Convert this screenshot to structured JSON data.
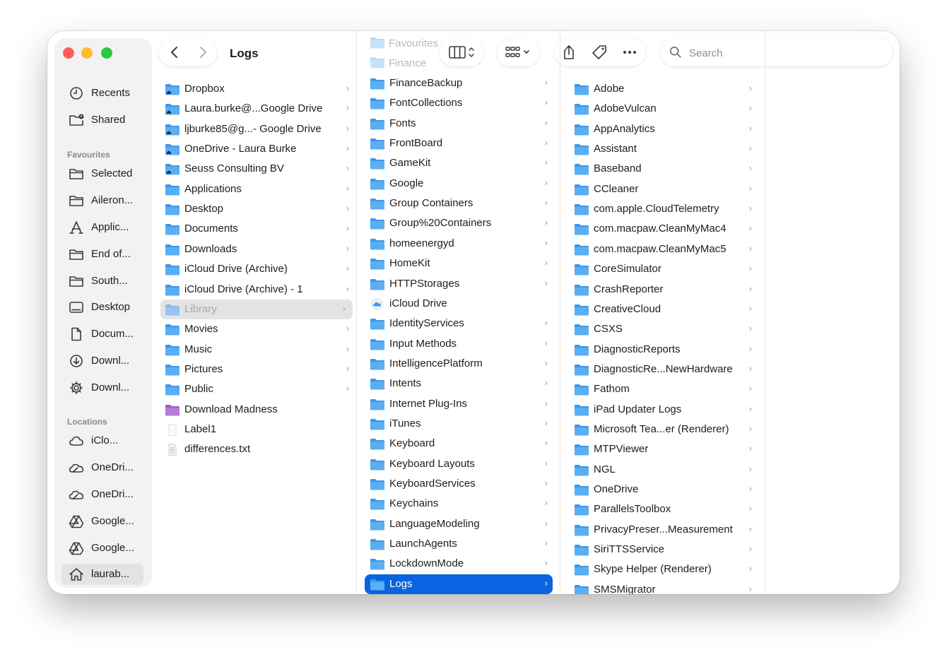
{
  "window": {
    "title": "Logs"
  },
  "colors": {
    "folder": "#5aaef4",
    "folder_tab": "#3e97e8",
    "selection": "#0a63e0",
    "purple_folder": "#b77ad9"
  },
  "sidebar": {
    "favourites_header": "Favourites",
    "locations_header": "Locations",
    "items": [
      {
        "label": "Recents",
        "icon": "clock-icon"
      },
      {
        "label": "Shared",
        "icon": "shared-folder-icon"
      },
      {
        "label": "Selected",
        "icon": "folder-icon"
      },
      {
        "label": "Aileron...",
        "icon": "folder-icon"
      },
      {
        "label": "Applic...",
        "icon": "applications-icon"
      },
      {
        "label": "End of...",
        "icon": "folder-icon"
      },
      {
        "label": "South...",
        "icon": "folder-icon"
      },
      {
        "label": "Desktop",
        "icon": "desktop-icon"
      },
      {
        "label": "Docum...",
        "icon": "document-icon"
      },
      {
        "label": "Downl...",
        "icon": "download-icon"
      },
      {
        "label": "Downl...",
        "icon": "gear-icon"
      },
      {
        "label": "iClo...",
        "icon": "cloud-icon"
      },
      {
        "label": "OneDri...",
        "icon": "onedrive-icon"
      },
      {
        "label": "OneDri...",
        "icon": "onedrive-icon"
      },
      {
        "label": "Google...",
        "icon": "google-drive-icon"
      },
      {
        "label": "Google...",
        "icon": "google-drive-icon"
      },
      {
        "label": "laurab...",
        "icon": "home-icon"
      }
    ]
  },
  "toolbar": {
    "search_placeholder": "Search",
    "ghost_rows": [
      "Favourites",
      "Finance"
    ]
  },
  "columns": [
    {
      "items": [
        {
          "name": "Dropbox",
          "icon": "cloud-folder-icon",
          "chevron": true
        },
        {
          "name": "Laura.burke@...Google Drive",
          "icon": "cloud-folder-icon",
          "chevron": true
        },
        {
          "name": "ljburke85@g...- Google Drive",
          "icon": "cloud-folder-icon",
          "chevron": true
        },
        {
          "name": "OneDrive - Laura Burke",
          "icon": "cloud-folder-icon",
          "chevron": true
        },
        {
          "name": "Seuss Consulting BV",
          "icon": "cloud-folder-icon",
          "chevron": true
        },
        {
          "name": "Applications",
          "icon": "folder-icon",
          "chevron": true
        },
        {
          "name": "Desktop",
          "icon": "folder-icon",
          "chevron": true
        },
        {
          "name": "Documents",
          "icon": "folder-icon",
          "chevron": true
        },
        {
          "name": "Downloads",
          "icon": "folder-icon",
          "chevron": true
        },
        {
          "name": "iCloud Drive (Archive)",
          "icon": "folder-icon",
          "chevron": true
        },
        {
          "name": "iCloud Drive (Archive) - 1",
          "icon": "folder-icon",
          "chevron": true
        },
        {
          "name": "Library",
          "icon": "folder-icon",
          "chevron": true,
          "state": "dim"
        },
        {
          "name": "Movies",
          "icon": "folder-icon",
          "chevron": true
        },
        {
          "name": "Music",
          "icon": "folder-icon",
          "chevron": true
        },
        {
          "name": "Pictures",
          "icon": "folder-icon",
          "chevron": true
        },
        {
          "name": "Public",
          "icon": "folder-icon",
          "chevron": true
        },
        {
          "name": "Download Madness",
          "icon": "purple-folder-icon",
          "chevron": false
        },
        {
          "name": "Label1",
          "icon": "blank-file-icon",
          "chevron": false
        },
        {
          "name": "differences.txt",
          "icon": "text-file-icon",
          "chevron": false
        }
      ]
    },
    {
      "items": [
        {
          "name": "FinanceBackup",
          "icon": "folder-icon",
          "chevron": true
        },
        {
          "name": "FontCollections",
          "icon": "folder-icon",
          "chevron": true
        },
        {
          "name": "Fonts",
          "icon": "folder-icon",
          "chevron": true
        },
        {
          "name": "FrontBoard",
          "icon": "folder-icon",
          "chevron": true
        },
        {
          "name": "GameKit",
          "icon": "folder-icon",
          "chevron": true
        },
        {
          "name": "Google",
          "icon": "folder-icon",
          "chevron": true
        },
        {
          "name": "Group Containers",
          "icon": "folder-icon",
          "chevron": true
        },
        {
          "name": "Group%20Containers",
          "icon": "folder-icon",
          "chevron": true
        },
        {
          "name": "homeenergyd",
          "icon": "folder-icon",
          "chevron": true
        },
        {
          "name": "HomeKit",
          "icon": "folder-icon",
          "chevron": true
        },
        {
          "name": "HTTPStorages",
          "icon": "folder-icon",
          "chevron": true
        },
        {
          "name": "iCloud Drive",
          "icon": "icloud-icon",
          "chevron": false
        },
        {
          "name": "IdentityServices",
          "icon": "folder-icon",
          "chevron": true
        },
        {
          "name": "Input Methods",
          "icon": "folder-icon",
          "chevron": true
        },
        {
          "name": "IntelligencePlatform",
          "icon": "folder-icon",
          "chevron": true
        },
        {
          "name": "Intents",
          "icon": "folder-icon",
          "chevron": true
        },
        {
          "name": "Internet Plug-Ins",
          "icon": "folder-icon",
          "chevron": true
        },
        {
          "name": "iTunes",
          "icon": "folder-icon",
          "chevron": true
        },
        {
          "name": "Keyboard",
          "icon": "folder-icon",
          "chevron": true
        },
        {
          "name": "Keyboard Layouts",
          "icon": "folder-icon",
          "chevron": true
        },
        {
          "name": "KeyboardServices",
          "icon": "folder-icon",
          "chevron": true
        },
        {
          "name": "Keychains",
          "icon": "folder-icon",
          "chevron": true
        },
        {
          "name": "LanguageModeling",
          "icon": "folder-icon",
          "chevron": true
        },
        {
          "name": "LaunchAgents",
          "icon": "folder-icon",
          "chevron": true
        },
        {
          "name": "LockdownMode",
          "icon": "folder-icon",
          "chevron": true
        },
        {
          "name": "Logs",
          "icon": "folder-icon",
          "chevron": true,
          "state": "selected"
        }
      ]
    },
    {
      "items": [
        {
          "name": "Adobe",
          "icon": "folder-icon",
          "chevron": true
        },
        {
          "name": "AdobeVulcan",
          "icon": "folder-icon",
          "chevron": true
        },
        {
          "name": "AppAnalytics",
          "icon": "folder-icon",
          "chevron": true
        },
        {
          "name": "Assistant",
          "icon": "folder-icon",
          "chevron": true
        },
        {
          "name": "Baseband",
          "icon": "folder-icon",
          "chevron": true
        },
        {
          "name": "CCleaner",
          "icon": "folder-icon",
          "chevron": true
        },
        {
          "name": "com.apple.CloudTelemetry",
          "icon": "folder-icon",
          "chevron": true
        },
        {
          "name": "com.macpaw.CleanMyMac4",
          "icon": "folder-icon",
          "chevron": true
        },
        {
          "name": "com.macpaw.CleanMyMac5",
          "icon": "folder-icon",
          "chevron": true
        },
        {
          "name": "CoreSimulator",
          "icon": "folder-icon",
          "chevron": true
        },
        {
          "name": "CrashReporter",
          "icon": "folder-icon",
          "chevron": true
        },
        {
          "name": "CreativeCloud",
          "icon": "folder-icon",
          "chevron": true
        },
        {
          "name": "CSXS",
          "icon": "folder-icon",
          "chevron": true
        },
        {
          "name": "DiagnosticReports",
          "icon": "folder-icon",
          "chevron": true
        },
        {
          "name": "DiagnosticRe...NewHardware",
          "icon": "folder-icon",
          "chevron": true
        },
        {
          "name": "Fathom",
          "icon": "folder-icon",
          "chevron": true
        },
        {
          "name": "iPad Updater Logs",
          "icon": "folder-icon",
          "chevron": true
        },
        {
          "name": "Microsoft Tea...er (Renderer)",
          "icon": "folder-icon",
          "chevron": true
        },
        {
          "name": "MTPViewer",
          "icon": "folder-icon",
          "chevron": true
        },
        {
          "name": "NGL",
          "icon": "folder-icon",
          "chevron": true
        },
        {
          "name": "OneDrive",
          "icon": "folder-icon",
          "chevron": true
        },
        {
          "name": "ParallelsToolbox",
          "icon": "folder-icon",
          "chevron": true
        },
        {
          "name": "PrivacyPreser...Measurement",
          "icon": "folder-icon",
          "chevron": true
        },
        {
          "name": "SiriTTSService",
          "icon": "folder-icon",
          "chevron": true
        },
        {
          "name": "Skype Helper (Renderer)",
          "icon": "folder-icon",
          "chevron": true
        },
        {
          "name": "SMSMigrator",
          "icon": "folder-icon",
          "chevron": true
        }
      ]
    }
  ]
}
